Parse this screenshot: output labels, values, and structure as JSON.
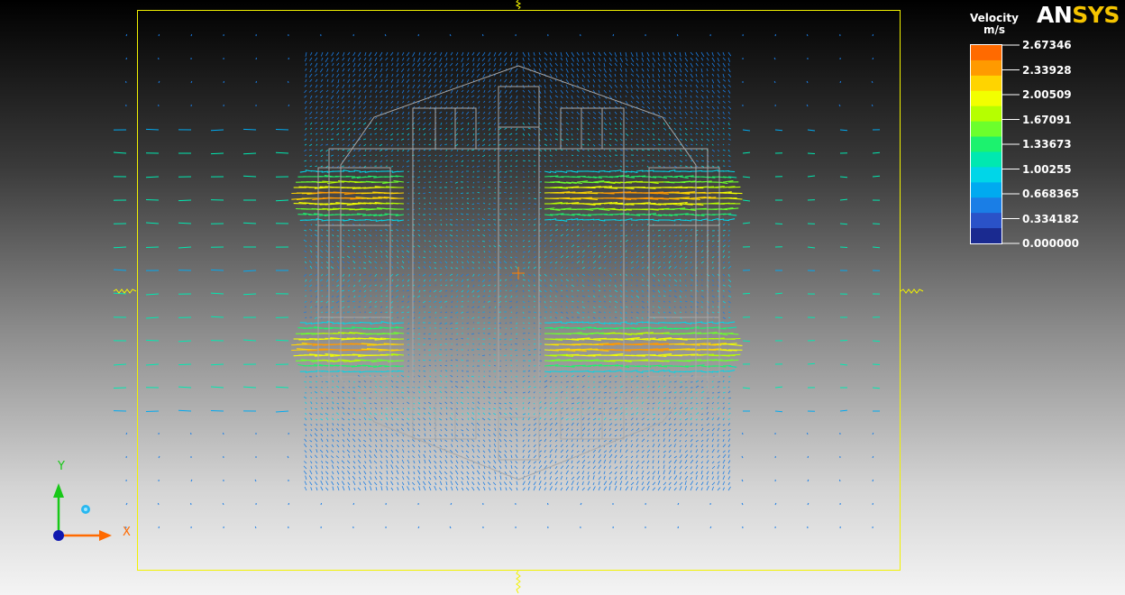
{
  "app": {
    "brand_pre": "AN",
    "brand_accent": "SYS"
  },
  "legend": {
    "title_line1": "Velocity",
    "title_line2": "m/s",
    "labels": [
      "2.67346",
      "2.33928",
      "2.00509",
      "1.67091",
      "1.33673",
      "1.00255",
      "0.668365",
      "0.334182",
      "0.000000"
    ],
    "colors": [
      "#ff6a00",
      "#ff9a00",
      "#ffd400",
      "#f2ff00",
      "#b6ff00",
      "#6cff2c",
      "#1cf26e",
      "#00e8b0",
      "#00d6e8",
      "#00aaf0",
      "#1a7ee6",
      "#2a52c8",
      "#1a2a90"
    ]
  },
  "triad": {
    "x_label": "X",
    "y_label": "Y"
  },
  "colors": {
    "viewport_border": "#f2f200",
    "geometry_line": "#b0b0b0",
    "x_axis": "#ff6a00",
    "y_axis": "#18c818",
    "origin": "#1018b0",
    "eye_marker": "#28b8f0",
    "center_cross": "#ff8000"
  }
}
